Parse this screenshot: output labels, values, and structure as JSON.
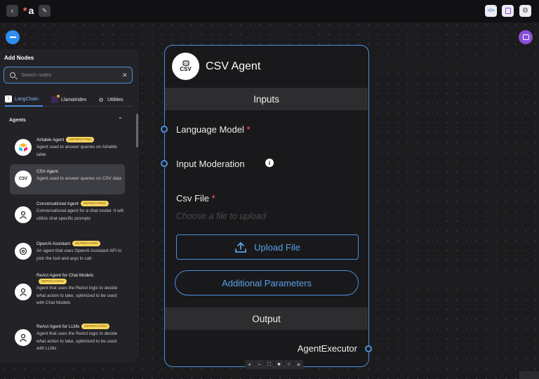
{
  "topbar": {
    "title_marker": "*",
    "title": "a",
    "back_icon": "chevron-left-icon",
    "edit_icon": "pencil-icon",
    "right_icons": [
      "code-icon",
      "save-icon",
      "settings-icon"
    ]
  },
  "add_nodes": {
    "title": "Add Nodes",
    "search_placeholder": "Search nodes",
    "tabs": [
      {
        "label": "LangChain",
        "active": true
      },
      {
        "label": "LlamaIndex",
        "active": false
      },
      {
        "label": "Utilities",
        "active": false
      }
    ],
    "section": "Agents",
    "items": [
      {
        "name": "Airtable Agent",
        "badge": "DEPRECATING",
        "description": "Agent used to answer queries on Airtable table",
        "icon": "airtable-icon"
      },
      {
        "name": "CSV Agent",
        "badge": "",
        "description": "Agent used to answer queries on CSV data",
        "icon": "csv-icon"
      },
      {
        "name": "Conversational Agent",
        "badge": "DEPRECATING",
        "description": "Conversational agent for a chat model. It will utilize chat specific prompts",
        "icon": "agent-icon"
      },
      {
        "name": "OpenAI Assistant",
        "badge": "DEPRECATING",
        "description": "An agent that uses OpenAI Assistant API to pick the tool and args to call",
        "icon": "openai-icon"
      },
      {
        "name": "ReAct Agent for Chat Models",
        "badge": "DEPRECATING",
        "description": "Agent that uses the ReAct logic to decide what action to take, optimized to be used with Chat Models",
        "icon": "agent-icon"
      },
      {
        "name": "ReAct Agent for LLMs",
        "badge": "DEPRECATING",
        "description": "Agent that uses the ReAct logic to decide what action to take, optimized to be used with LLMs",
        "icon": "agent-icon"
      }
    ]
  },
  "node": {
    "title": "CSV Agent",
    "logo_text": "CSV",
    "inputs_header": "Inputs",
    "fields": [
      {
        "label": "Language Model",
        "required": "*"
      },
      {
        "label": "Input Moderation",
        "required": ""
      },
      {
        "label": "Csv File",
        "required": "*"
      }
    ],
    "file_placeholder": "Choose a file to upload",
    "upload_button": "Upload File",
    "additional_params_button": "Additional Parameters",
    "output_header": "Output",
    "output_label": "AgentExecutor"
  },
  "colors": {
    "accent": "#4a8fd8",
    "badge": "#f7d560",
    "required": "#ff5a5a"
  }
}
